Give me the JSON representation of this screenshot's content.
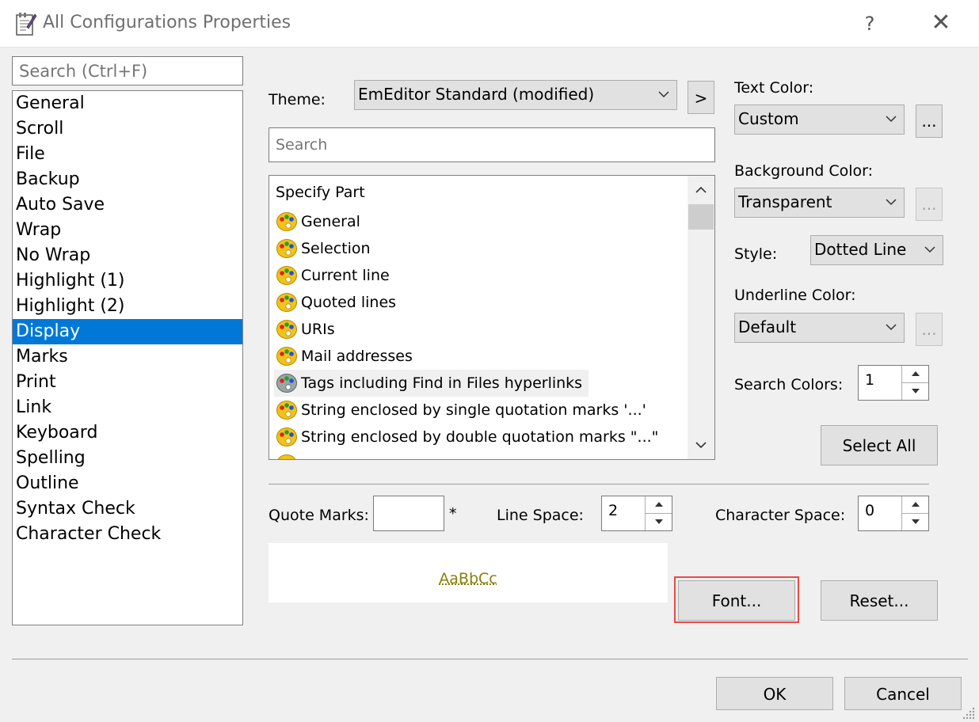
{
  "window": {
    "title": "All Configurations Properties",
    "help_label": "?",
    "close_label": "✕"
  },
  "categories": {
    "search_placeholder": "Search (Ctrl+F)",
    "items": [
      {
        "label": "General",
        "selected": false
      },
      {
        "label": "Scroll",
        "selected": false
      },
      {
        "label": "File",
        "selected": false
      },
      {
        "label": "Backup",
        "selected": false
      },
      {
        "label": "Auto Save",
        "selected": false
      },
      {
        "label": "Wrap",
        "selected": false
      },
      {
        "label": "No Wrap",
        "selected": false
      },
      {
        "label": "Highlight (1)",
        "selected": false
      },
      {
        "label": "Highlight (2)",
        "selected": false
      },
      {
        "label": "Display",
        "selected": true
      },
      {
        "label": "Marks",
        "selected": false
      },
      {
        "label": "Print",
        "selected": false
      },
      {
        "label": "Link",
        "selected": false
      },
      {
        "label": "Keyboard",
        "selected": false
      },
      {
        "label": "Spelling",
        "selected": false
      },
      {
        "label": "Outline",
        "selected": false
      },
      {
        "label": "Syntax Check",
        "selected": false
      },
      {
        "label": "Character Check",
        "selected": false
      }
    ]
  },
  "theme": {
    "label": "Theme:",
    "value": "EmEditor Standard (modified)",
    "more_button": ">"
  },
  "part_search": {
    "placeholder": "Search"
  },
  "parts": {
    "header": "Specify Part",
    "items": [
      {
        "label": "General",
        "icon": "color-palette-icon"
      },
      {
        "label": "Selection",
        "icon": "color-palette-icon"
      },
      {
        "label": "Current line",
        "icon": "color-palette-icon"
      },
      {
        "label": "Quoted lines",
        "icon": "color-palette-icon"
      },
      {
        "label": "URIs",
        "icon": "color-palette-icon"
      },
      {
        "label": "Mail addresses",
        "icon": "color-palette-icon"
      },
      {
        "label": "Tags including Find in Files hyperlinks",
        "icon": "color-palette-icon"
      },
      {
        "label": "String enclosed by single quotation marks '...'",
        "icon": "color-palette-icon"
      },
      {
        "label": "String enclosed by double quotation marks \"...\"",
        "icon": "color-palette-icon"
      }
    ]
  },
  "text_color": {
    "label": "Text Color:",
    "value": "Custom",
    "button": "..."
  },
  "background_color": {
    "label": "Background Color:",
    "value": "Transparent",
    "button": "..."
  },
  "style": {
    "label": "Style:",
    "value": "Dotted Line"
  },
  "underline_color": {
    "label": "Underline Color:",
    "value": "Default",
    "button": "..."
  },
  "search_colors": {
    "label": "Search Colors:",
    "value": "1"
  },
  "select_all_button": "Select All",
  "quote_marks": {
    "label": "Quote Marks:",
    "value": "",
    "asterisk": "*"
  },
  "line_space": {
    "label": "Line Space:",
    "value": "2"
  },
  "character_space": {
    "label": "Character Space:",
    "value": "0"
  },
  "preview": {
    "sample_text": "AaBbCc",
    "text_color": "#8a7f0a"
  },
  "buttons": {
    "font": "Font...",
    "reset": "Reset...",
    "ok": "OK",
    "cancel": "Cancel"
  },
  "colors": {
    "selection": "#0078d7",
    "highlight_border": "#e84a4a"
  }
}
